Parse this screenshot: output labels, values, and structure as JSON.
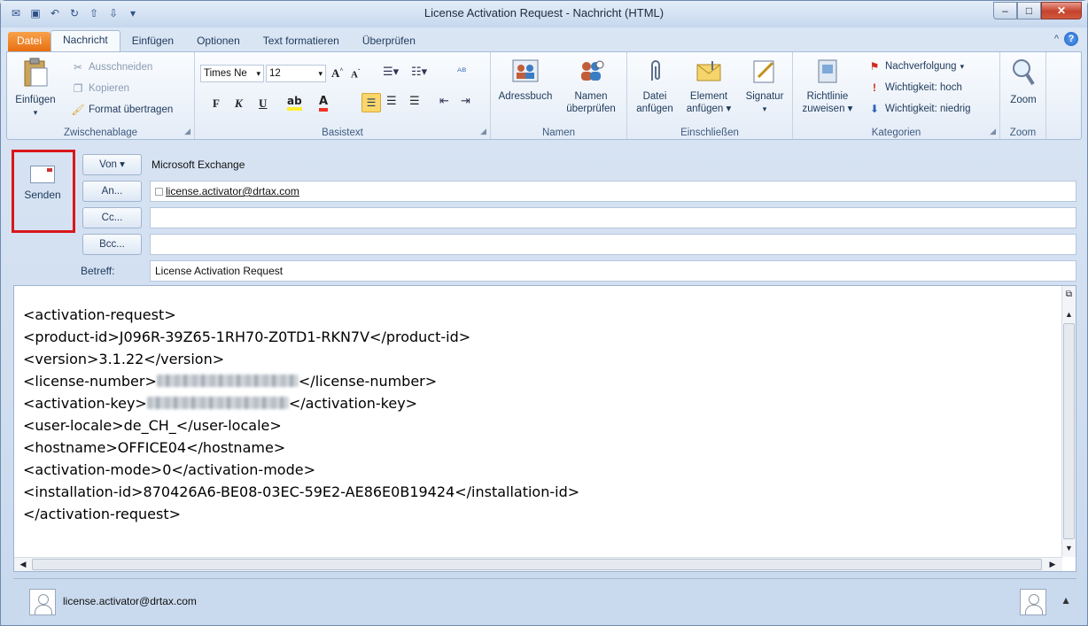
{
  "window": {
    "title": "License Activation Request - Nachricht (HTML)",
    "controls": {
      "minimize": "–",
      "maximize": "□",
      "close": "✕"
    }
  },
  "tabs": [
    "Datei",
    "Nachricht",
    "Einfügen",
    "Optionen",
    "Text formatieren",
    "Überprüfen"
  ],
  "ribbon": {
    "clipboard": {
      "label": "Zwischenablage",
      "paste": "Einfügen",
      "cut": "Ausschneiden",
      "copy": "Kopieren",
      "format_painter": "Format übertragen"
    },
    "basic_text": {
      "label": "Basistext",
      "font_name": "Times Ne",
      "font_size": "12",
      "bold": "F",
      "italic": "K",
      "underline": "U"
    },
    "names": {
      "label": "Namen",
      "address_book": "Adressbuch",
      "check_names_1": "Namen",
      "check_names_2": "überprüfen"
    },
    "include": {
      "label": "Einschließen",
      "attach_file_1": "Datei",
      "attach_file_2": "anfügen",
      "attach_item_1": "Element",
      "attach_item_2": "anfügen",
      "signature": "Signatur"
    },
    "tags": {
      "label": "Kategorien",
      "policy_1": "Richtlinie",
      "policy_2": "zuweisen",
      "followup": "Nachverfolgung",
      "high": "Wichtigkeit: hoch",
      "low": "Wichtigkeit: niedrig"
    },
    "zoom": {
      "label": "Zoom",
      "button": "Zoom"
    }
  },
  "compose": {
    "send": "Senden",
    "from_button": "Von ▾",
    "from_value": "Microsoft Exchange",
    "to_button": "An...",
    "to_value": "license.activator@drtax.com",
    "cc_button": "Cc...",
    "bcc_button": "Bcc...",
    "subject_label": "Betreff:",
    "subject_value": "License Activation Request"
  },
  "body": {
    "line1": "<activation-request>",
    "line2": "<product-id>J096R-39Z65-1RH70-Z0TD1-RKN7V</product-id>",
    "line3": "<version>3.1.22</version>",
    "line4_open": "<license-number>",
    "line4_close": "</license-number>",
    "line5_open": "<activation-key>",
    "line5_close": "</activation-key>",
    "line6": "<user-locale>de_CH_</user-locale>",
    "line7": "<hostname>OFFICE04</hostname>",
    "line8": "<activation-mode>0</activation-mode>",
    "line9": "<installation-id>870426A6-BE08-03EC-59E2-AE86E0B19424</installation-id>",
    "line10": "</activation-request>"
  },
  "people_pane": {
    "name": "license.activator@drtax.com"
  },
  "colors": {
    "highlight": "#d9161a",
    "file_tab": "#e86f11",
    "ribbon_text": "#1e395b"
  }
}
